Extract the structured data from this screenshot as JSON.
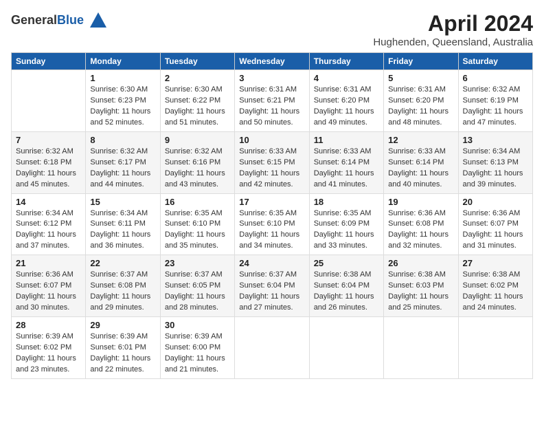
{
  "header": {
    "logo_general": "General",
    "logo_blue": "Blue",
    "month": "April 2024",
    "location": "Hughenden, Queensland, Australia"
  },
  "days_of_week": [
    "Sunday",
    "Monday",
    "Tuesday",
    "Wednesday",
    "Thursday",
    "Friday",
    "Saturday"
  ],
  "weeks": [
    [
      {
        "day": "",
        "info": ""
      },
      {
        "day": "1",
        "info": "Sunrise: 6:30 AM\nSunset: 6:23 PM\nDaylight: 11 hours\nand 52 minutes."
      },
      {
        "day": "2",
        "info": "Sunrise: 6:30 AM\nSunset: 6:22 PM\nDaylight: 11 hours\nand 51 minutes."
      },
      {
        "day": "3",
        "info": "Sunrise: 6:31 AM\nSunset: 6:21 PM\nDaylight: 11 hours\nand 50 minutes."
      },
      {
        "day": "4",
        "info": "Sunrise: 6:31 AM\nSunset: 6:20 PM\nDaylight: 11 hours\nand 49 minutes."
      },
      {
        "day": "5",
        "info": "Sunrise: 6:31 AM\nSunset: 6:20 PM\nDaylight: 11 hours\nand 48 minutes."
      },
      {
        "day": "6",
        "info": "Sunrise: 6:32 AM\nSunset: 6:19 PM\nDaylight: 11 hours\nand 47 minutes."
      }
    ],
    [
      {
        "day": "7",
        "info": "Sunrise: 6:32 AM\nSunset: 6:18 PM\nDaylight: 11 hours\nand 45 minutes."
      },
      {
        "day": "8",
        "info": "Sunrise: 6:32 AM\nSunset: 6:17 PM\nDaylight: 11 hours\nand 44 minutes."
      },
      {
        "day": "9",
        "info": "Sunrise: 6:32 AM\nSunset: 6:16 PM\nDaylight: 11 hours\nand 43 minutes."
      },
      {
        "day": "10",
        "info": "Sunrise: 6:33 AM\nSunset: 6:15 PM\nDaylight: 11 hours\nand 42 minutes."
      },
      {
        "day": "11",
        "info": "Sunrise: 6:33 AM\nSunset: 6:14 PM\nDaylight: 11 hours\nand 41 minutes."
      },
      {
        "day": "12",
        "info": "Sunrise: 6:33 AM\nSunset: 6:14 PM\nDaylight: 11 hours\nand 40 minutes."
      },
      {
        "day": "13",
        "info": "Sunrise: 6:34 AM\nSunset: 6:13 PM\nDaylight: 11 hours\nand 39 minutes."
      }
    ],
    [
      {
        "day": "14",
        "info": "Sunrise: 6:34 AM\nSunset: 6:12 PM\nDaylight: 11 hours\nand 37 minutes."
      },
      {
        "day": "15",
        "info": "Sunrise: 6:34 AM\nSunset: 6:11 PM\nDaylight: 11 hours\nand 36 minutes."
      },
      {
        "day": "16",
        "info": "Sunrise: 6:35 AM\nSunset: 6:10 PM\nDaylight: 11 hours\nand 35 minutes."
      },
      {
        "day": "17",
        "info": "Sunrise: 6:35 AM\nSunset: 6:10 PM\nDaylight: 11 hours\nand 34 minutes."
      },
      {
        "day": "18",
        "info": "Sunrise: 6:35 AM\nSunset: 6:09 PM\nDaylight: 11 hours\nand 33 minutes."
      },
      {
        "day": "19",
        "info": "Sunrise: 6:36 AM\nSunset: 6:08 PM\nDaylight: 11 hours\nand 32 minutes."
      },
      {
        "day": "20",
        "info": "Sunrise: 6:36 AM\nSunset: 6:07 PM\nDaylight: 11 hours\nand 31 minutes."
      }
    ],
    [
      {
        "day": "21",
        "info": "Sunrise: 6:36 AM\nSunset: 6:07 PM\nDaylight: 11 hours\nand 30 minutes."
      },
      {
        "day": "22",
        "info": "Sunrise: 6:37 AM\nSunset: 6:08 PM\nDaylight: 11 hours\nand 29 minutes."
      },
      {
        "day": "23",
        "info": "Sunrise: 6:37 AM\nSunset: 6:05 PM\nDaylight: 11 hours\nand 28 minutes."
      },
      {
        "day": "24",
        "info": "Sunrise: 6:37 AM\nSunset: 6:04 PM\nDaylight: 11 hours\nand 27 minutes."
      },
      {
        "day": "25",
        "info": "Sunrise: 6:38 AM\nSunset: 6:04 PM\nDaylight: 11 hours\nand 26 minutes."
      },
      {
        "day": "26",
        "info": "Sunrise: 6:38 AM\nSunset: 6:03 PM\nDaylight: 11 hours\nand 25 minutes."
      },
      {
        "day": "27",
        "info": "Sunrise: 6:38 AM\nSunset: 6:02 PM\nDaylight: 11 hours\nand 24 minutes."
      }
    ],
    [
      {
        "day": "28",
        "info": "Sunrise: 6:39 AM\nSunset: 6:02 PM\nDaylight: 11 hours\nand 23 minutes."
      },
      {
        "day": "29",
        "info": "Sunrise: 6:39 AM\nSunset: 6:01 PM\nDaylight: 11 hours\nand 22 minutes."
      },
      {
        "day": "30",
        "info": "Sunrise: 6:39 AM\nSunset: 6:00 PM\nDaylight: 11 hours\nand 21 minutes."
      },
      {
        "day": "",
        "info": ""
      },
      {
        "day": "",
        "info": ""
      },
      {
        "day": "",
        "info": ""
      },
      {
        "day": "",
        "info": ""
      }
    ]
  ]
}
